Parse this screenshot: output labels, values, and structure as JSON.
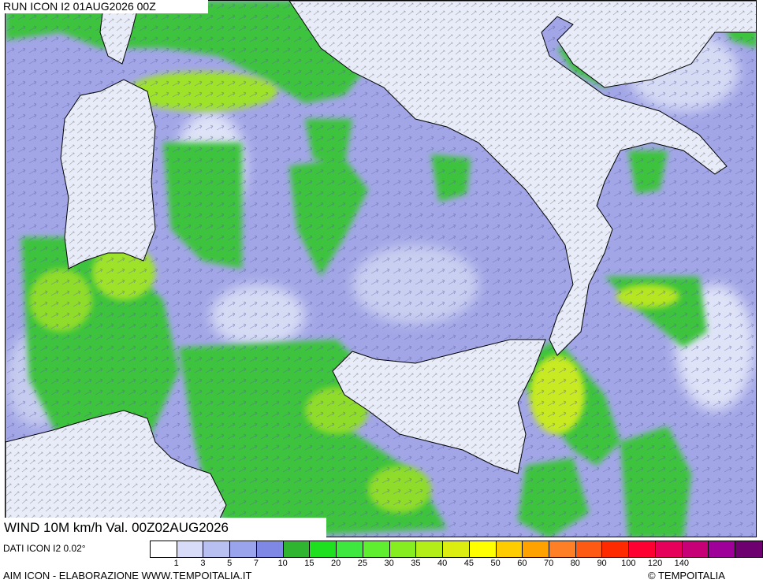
{
  "header": {
    "run_label": "RUN ICON I2 01AUG2026 00Z"
  },
  "map": {
    "variable_label": "WIND 10M km/h Val. 00Z02AUG2026",
    "sea_color": "#a2a6e6",
    "land_color": "#e8ecf8",
    "green_color": "#3ec33e",
    "yellowgreen_color": "#9ee22a"
  },
  "legend": {
    "source_label": "DATI ICON I2 0.02°",
    "colors": [
      "#ffffff",
      "#d8dcf8",
      "#b8c0f2",
      "#9aa4ec",
      "#7f88e4",
      "#2fb52f",
      "#1ee01e",
      "#3fe83f",
      "#5fee30",
      "#86ee20",
      "#b4ee18",
      "#dcee10",
      "#ffff00",
      "#ffcc00",
      "#ffa200",
      "#ff7f27",
      "#ff5a14",
      "#ff2a00",
      "#ff0033",
      "#e6005c",
      "#c80078",
      "#a0009a",
      "#6e0070"
    ],
    "tick_labels": [
      "1",
      "3",
      "5",
      "7",
      "10",
      "15",
      "20",
      "25",
      "30",
      "35",
      "40",
      "45",
      "50",
      "60",
      "70",
      "80",
      "90",
      "100",
      "120",
      "140"
    ]
  },
  "footer": {
    "model_credit": "AIM ICON - ELABORAZIONE WWW.TEMPOITALIA.IT",
    "copyright": "© TEMPOITALIA"
  }
}
